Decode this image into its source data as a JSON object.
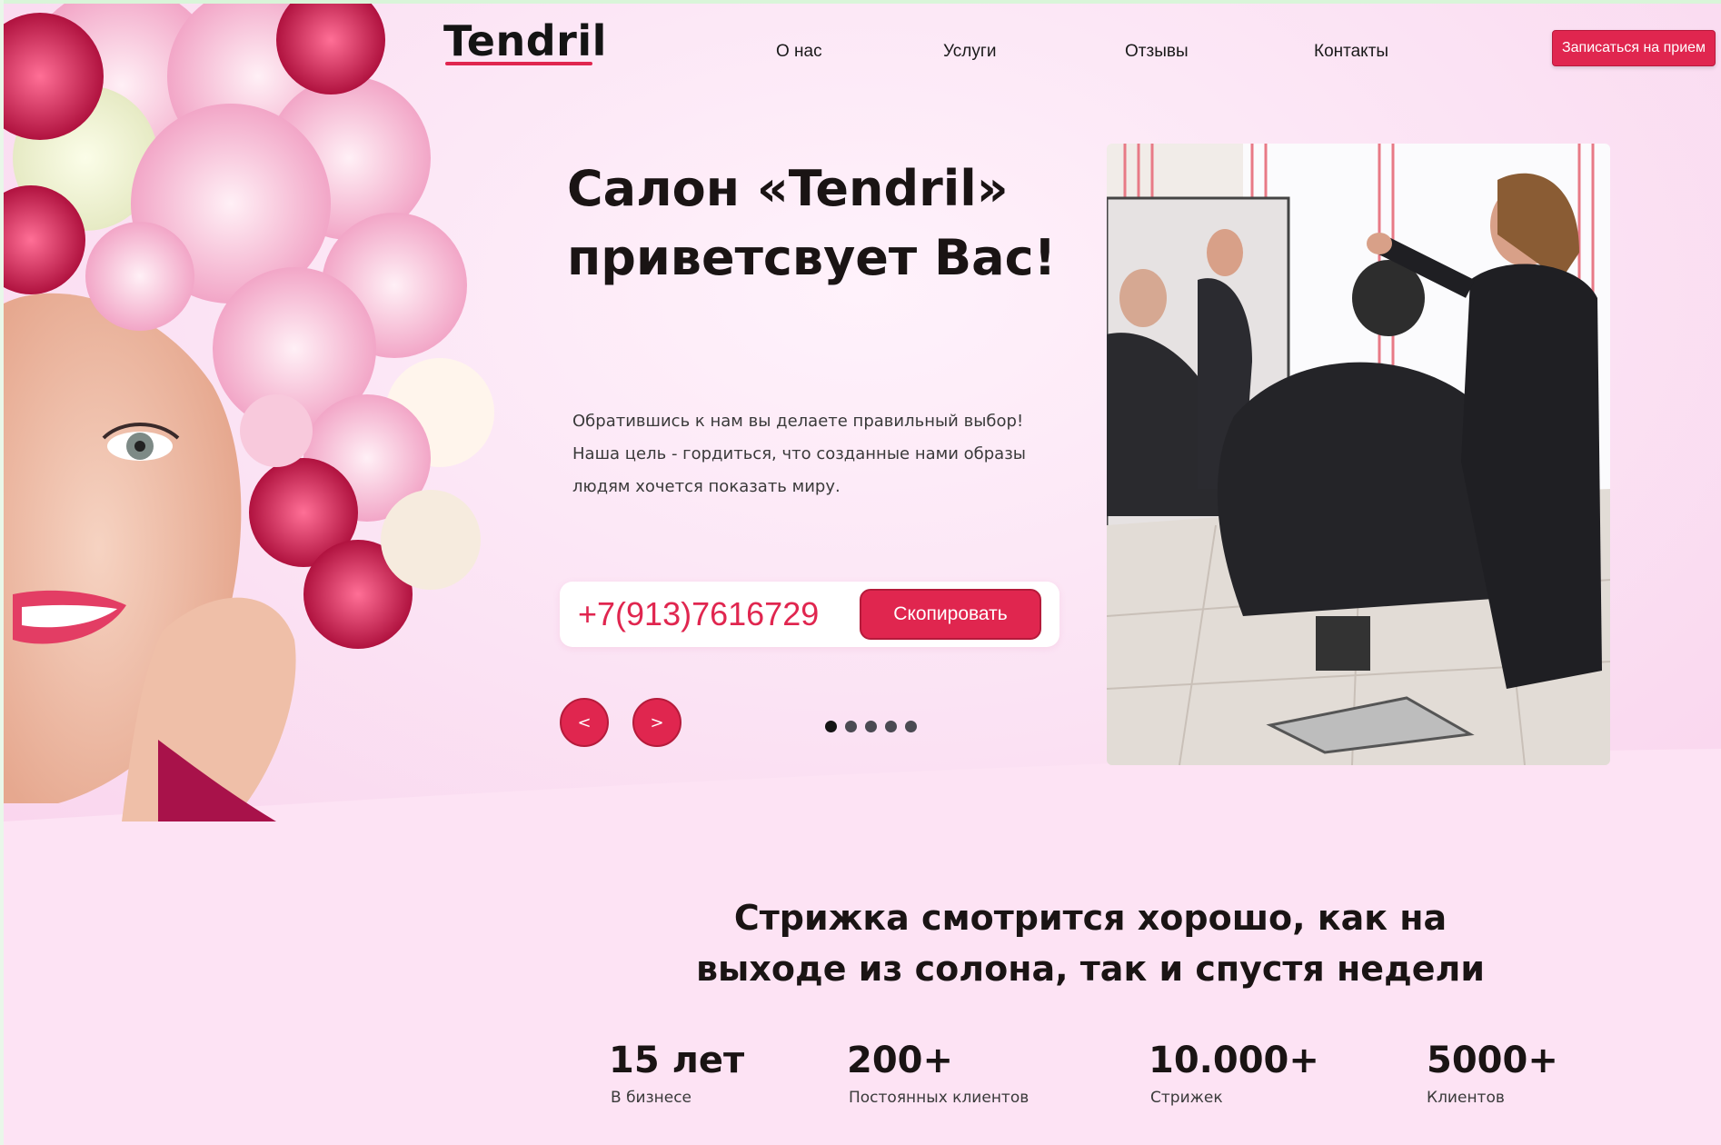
{
  "header": {
    "logo": "Tendril",
    "nav": [
      "О нас",
      "Услуги",
      "Отзывы",
      "Контакты"
    ],
    "cta_label": "Записаться на прием"
  },
  "hero": {
    "title_line1": "Салон «Tendril»",
    "title_line2": "приветсвует Вас!",
    "text_line1": "Обратившись к нам вы делаете правильный выбор!",
    "text_line2": "Наша цель - гордиться, что созданные нами образы",
    "text_line3": "людям хочется показать миру.",
    "phone": "+7(913)7616729",
    "copy_label": "Скопировать",
    "prev_label": "<",
    "next_label": ">",
    "slides_total": 5,
    "slide_active": 1
  },
  "stats_section": {
    "title_line1": "Стрижка смотрится хорошо, как на",
    "title_line2": "выходе из солона, так и спустя недели",
    "items": [
      {
        "value": "15 лет",
        "label": "В бизнесе"
      },
      {
        "value": "200+",
        "label": "Постоянных клиентов"
      },
      {
        "value": "10.000+",
        "label": "Стрижек"
      },
      {
        "value": "5000+",
        "label": "Клиентов"
      }
    ]
  },
  "colors": {
    "accent": "#e0264f",
    "background": "#fde3f4",
    "text": "#1a1414"
  }
}
